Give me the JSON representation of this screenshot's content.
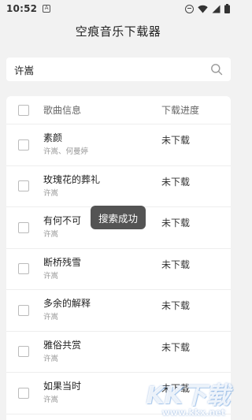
{
  "status_bar": {
    "time": "10:52",
    "notification_icon": "a-box-icon",
    "icons": [
      "do-not-disturb-icon",
      "wifi-icon",
      "signal-icon",
      "battery-icon"
    ]
  },
  "app": {
    "title": "空痕音乐下载器"
  },
  "search": {
    "value": "许嵩",
    "icon": "search-icon"
  },
  "table": {
    "header": {
      "info": "歌曲信息",
      "progress": "下载进度"
    },
    "rows": [
      {
        "title": "素颜",
        "artist": "许嵩、何曼婷",
        "status": "未下载"
      },
      {
        "title": "玫瑰花的葬礼",
        "artist": "许嵩",
        "status": "未下载"
      },
      {
        "title": "有何不可",
        "artist": "许嵩",
        "status": "未下载"
      },
      {
        "title": "断桥残雪",
        "artist": "许嵩",
        "status": "未下载"
      },
      {
        "title": "多余的解释",
        "artist": "许嵩",
        "status": "未下载"
      },
      {
        "title": "雅俗共赏",
        "artist": "许嵩",
        "status": "未下载"
      },
      {
        "title": "如果当时",
        "artist": "许嵩",
        "status": "未下载"
      }
    ]
  },
  "toast": {
    "text": "搜索成功"
  },
  "watermark": {
    "logo": "KK下载",
    "url": "www.kkx.net"
  }
}
